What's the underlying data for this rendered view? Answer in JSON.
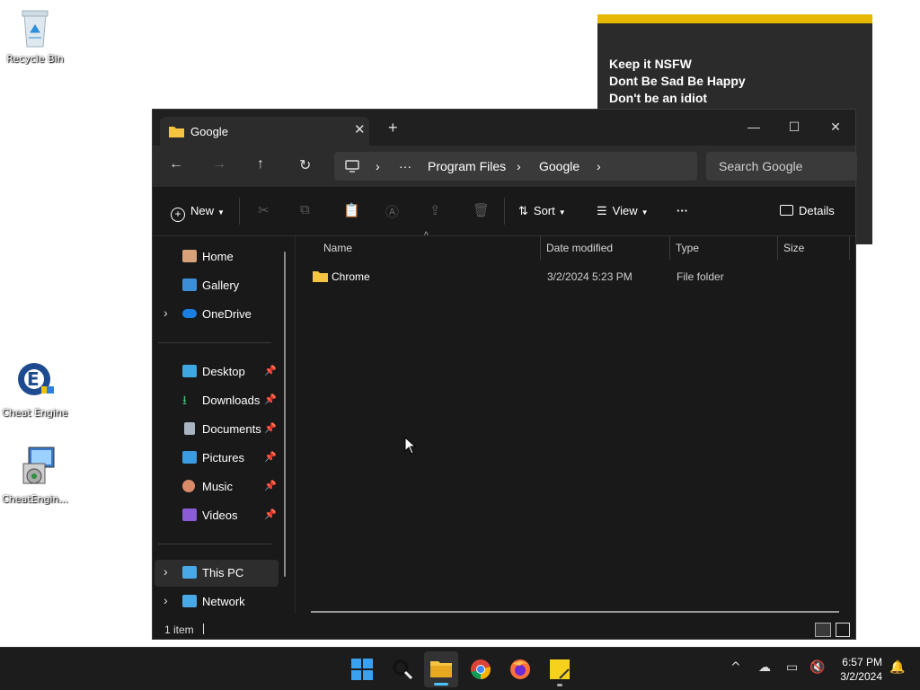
{
  "desktop": {
    "icons": [
      {
        "label": "Recycle Bin"
      },
      {
        "label": "Cheat Engine"
      },
      {
        "label": "CheatEngin..."
      }
    ]
  },
  "sticky_note": {
    "lines": [
      "Keep it NSFW",
      "Dont Be Sad Be Happy",
      "Don't be an idiot"
    ],
    "accent": "#e6b800"
  },
  "explorer": {
    "tab_title": "Google",
    "new_tab": "+",
    "window_controls": {
      "minimize": "—",
      "maximize": "☐",
      "close": "✕"
    },
    "nav": {
      "back": "←",
      "forward": "→",
      "up": "↑",
      "refresh": "↻"
    },
    "breadcrumb": {
      "more": "···",
      "items": [
        "Program Files",
        "Google"
      ],
      "sep": "›"
    },
    "search_placeholder": "Search Google",
    "toolbar": {
      "new_label": "New",
      "sort_label": "Sort",
      "view_label": "View",
      "more_label": "···",
      "details_label": "Details"
    },
    "sidebar": {
      "top": [
        {
          "label": "Home",
          "icon": "home-icon"
        },
        {
          "label": "Gallery",
          "icon": "gallery-icon"
        },
        {
          "label": "OneDrive",
          "icon": "onedrive-icon"
        }
      ],
      "pinned": [
        {
          "label": "Desktop",
          "icon": "desktop-folder-icon"
        },
        {
          "label": "Downloads",
          "icon": "downloads-icon"
        },
        {
          "label": "Documents",
          "icon": "documents-icon"
        },
        {
          "label": "Pictures",
          "icon": "pictures-icon"
        },
        {
          "label": "Music",
          "icon": "music-icon"
        },
        {
          "label": "Videos",
          "icon": "videos-icon"
        }
      ],
      "bottom": [
        {
          "label": "This PC",
          "icon": "this-pc-icon"
        },
        {
          "label": "Network",
          "icon": "network-icon"
        }
      ]
    },
    "columns": [
      "Name",
      "Date modified",
      "Type",
      "Size"
    ],
    "files": [
      {
        "name": "Chrome",
        "date": "3/2/2024 5:23 PM",
        "type": "File folder",
        "size": ""
      }
    ],
    "status": "1 item"
  },
  "taskbar": {
    "time": "6:57 PM",
    "date": "3/2/2024",
    "apps": [
      "start-icon",
      "search-icon",
      "file-explorer-icon",
      "chrome-icon",
      "firefox-icon",
      "sticky-notes-icon"
    ]
  }
}
